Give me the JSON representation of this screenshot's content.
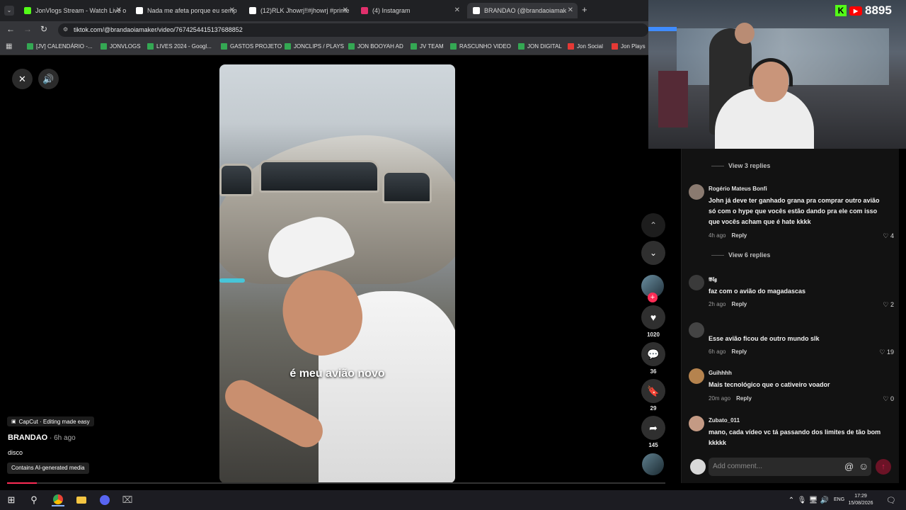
{
  "tabs": [
    {
      "label": "JonVlogs Stream - Watch Live o",
      "color": "#53fc18"
    },
    {
      "label": "Nada me afeta porque eu semp",
      "color": "#ffffff"
    },
    {
      "label": "(12)RLK Jhowrj!!#jhowrj #prime",
      "color": "#ffffff"
    },
    {
      "label": "(4) Instagram",
      "color": "#e1306c"
    },
    {
      "label": "BRANDAO (@brandaoiamak",
      "color": "#ffffff"
    }
  ],
  "new_tab": "+",
  "url": "tiktok.com/@brandaoiamaker/video/7674254415137688852",
  "bookmarks": [
    {
      "label": "[JV] CALENDÁRIO -...",
      "color": "#34a853"
    },
    {
      "label": "JONVLOGS",
      "color": "#34a853"
    },
    {
      "label": "LIVES 2024 - Googl...",
      "color": "#34a853"
    },
    {
      "label": "GASTOS PROJETO",
      "color": "#34a853"
    },
    {
      "label": "JONCLIPS / PLAYS",
      "color": "#34a853"
    },
    {
      "label": "JON BOOYAH AD",
      "color": "#34a853"
    },
    {
      "label": "JV TEAM",
      "color": "#34a853"
    },
    {
      "label": "RASCUNHO VIDEO",
      "color": "#34a853"
    },
    {
      "label": "JON DIGITAL",
      "color": "#34a853"
    },
    {
      "label": "Jon Social",
      "color": "#e53935"
    },
    {
      "label": "Jon Plays",
      "color": "#e53935"
    }
  ],
  "video": {
    "caption": "é meu avião novo",
    "capcut": "CapCut · Editing made easy",
    "author": "BRANDAO",
    "time": " · 6h ago",
    "description": "disco",
    "ai_badge": "Contains AI-generated media",
    "progress": 0.045
  },
  "rail": {
    "likes": "1020",
    "comments": "36",
    "saves": "29",
    "shares": "145"
  },
  "comments": {
    "top_replies": "View 3 replies",
    "items": [
      {
        "user": "Rogério Mateus Bonfi",
        "text": "John já deve ter ganhado grana pra comprar outro avião só com o hype que vocês estão dando pra ele com isso que vocês acham que é hate kkkk",
        "time": "4h ago",
        "reply": "Reply",
        "likes": "4",
        "replies": "View 6 replies"
      },
      {
        "user": "𝕭𝖑𝖌",
        "text": "faz com o avião do magadascas",
        "time": "2h ago",
        "reply": "Reply",
        "likes": "2"
      },
      {
        "user": "",
        "text": "Esse avião ficou de outro mundo slk",
        "time": "6h ago",
        "reply": "Reply",
        "likes": "19"
      },
      {
        "user": "Guihhhh",
        "text": "Mais tecnológico que o cativeiro voador",
        "time": "20m ago",
        "reply": "Reply",
        "likes": "0"
      },
      {
        "user": "Zubato_011",
        "text": "mano, cada vídeo vc tá passando dos limites de tão bom kkkkk",
        "time": "",
        "reply": "",
        "likes": ""
      }
    ],
    "placeholder": "Add comment...",
    "mention": "@",
    "emoji": "☺"
  },
  "stream": {
    "viewers": "8895",
    "kick_letter": "K",
    "yt_symbol": "▶"
  },
  "taskbar": {
    "time": "17:29",
    "date": "15/08/2026",
    "lang": "ENG"
  }
}
